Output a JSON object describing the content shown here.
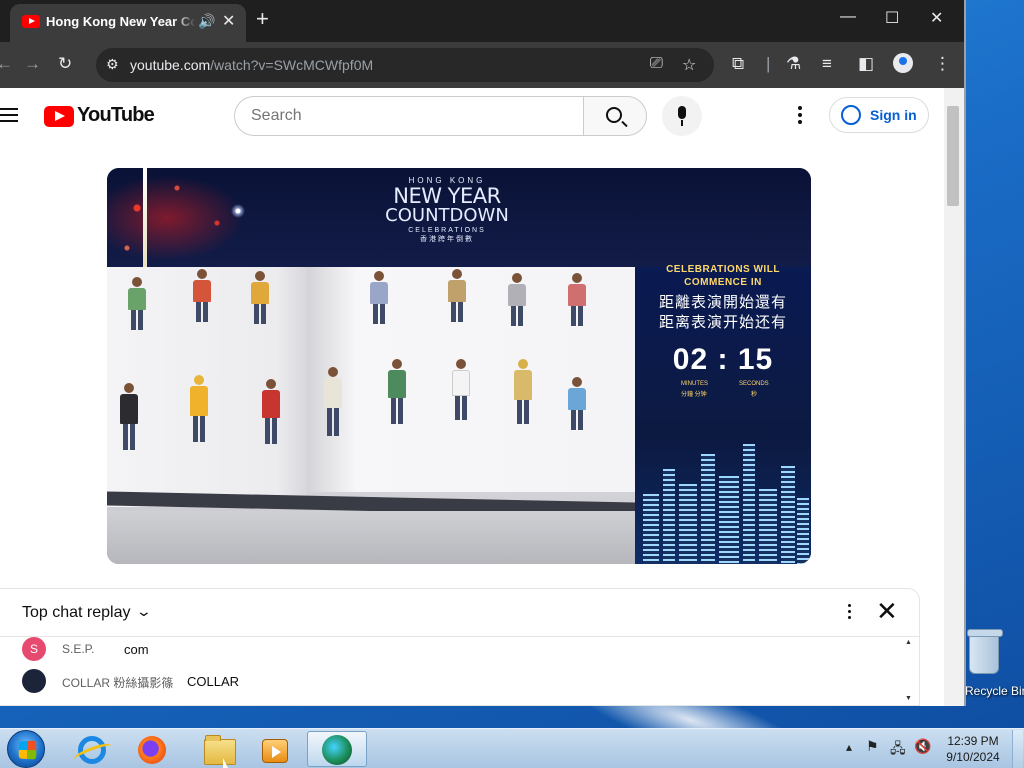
{
  "browser": {
    "tab_title": "Hong Kong New Year Countdown Celebrations",
    "url_main": "youtube.com",
    "url_path": "/watch?v=SWcMCWfpf0M"
  },
  "youtube": {
    "logo_text": "YouTube",
    "search_placeholder": "Search",
    "sign_in_label": "Sign in"
  },
  "video": {
    "brand_hk": "HONG KONG",
    "brand_new_year": "NEW YEAR",
    "brand_countdown": "COUNTDOWN",
    "brand_celebrations": "CELEBRATIONS",
    "brand_chinese": "香港跨年倒數",
    "commence_line1": "CELEBRATIONS WILL",
    "commence_line2": "COMMENCE IN",
    "zh_traditional": "距離表演開始還有",
    "zh_simplified": "距离表演开始还有",
    "timer": "02 : 15",
    "minutes_label": "MINUTES",
    "seconds_label": "SECONDS",
    "minutes_zh": "分鐘 分钟",
    "seconds_zh": "秒"
  },
  "chat": {
    "title": "Top chat replay",
    "messages": [
      {
        "avatar": "S",
        "author": "S.E.P.",
        "text": "com",
        "avatar_color": "#e64b6f"
      },
      {
        "avatar": "",
        "author": "COLLAR 粉絲攝影篠",
        "text": "COLLAR",
        "avatar_color": "#1b2438"
      }
    ]
  },
  "desktop": {
    "recycle_bin_label": "Recycle Bin"
  },
  "taskbar": {
    "time": "12:39 PM",
    "date": "9/10/2024"
  }
}
